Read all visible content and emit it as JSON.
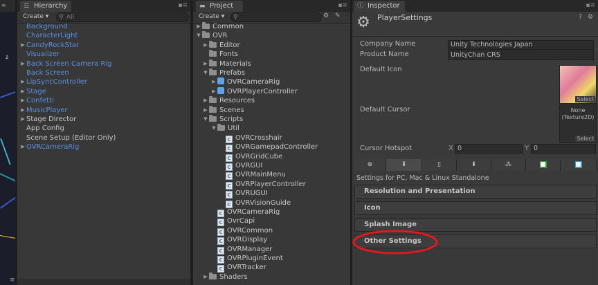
{
  "scene": {
    "axis_label": "z",
    "footer": "≡"
  },
  "hierarchy": {
    "tab_label": "Hierarchy",
    "create_label": "Create ▾",
    "search_placeholder": "All",
    "items": [
      {
        "label": "Background",
        "color": "blue",
        "arrow": ""
      },
      {
        "label": "CharacterLight",
        "color": "blue",
        "arrow": ""
      },
      {
        "label": "CandyRockStar",
        "color": "blue",
        "arrow": "▶"
      },
      {
        "label": "Visualizer",
        "color": "blue",
        "arrow": ""
      },
      {
        "label": "Back Screen Camera Rig",
        "color": "blue",
        "arrow": "▶"
      },
      {
        "label": "Back Screen",
        "color": "blue",
        "arrow": ""
      },
      {
        "label": "LipSyncController",
        "color": "blue",
        "arrow": "▶"
      },
      {
        "label": "Stage",
        "color": "blue",
        "arrow": "▶"
      },
      {
        "label": "Confetti",
        "color": "blue",
        "arrow": "▶"
      },
      {
        "label": "MusicPlayer",
        "color": "blue",
        "arrow": "▶"
      },
      {
        "label": "Stage Director",
        "color": "white",
        "arrow": "▶"
      },
      {
        "label": "App Config",
        "color": "white",
        "arrow": ""
      },
      {
        "label": "Scene Setup (Editor Only)",
        "color": "white",
        "arrow": ""
      },
      {
        "label": "OVRCameraRig",
        "color": "blue",
        "arrow": "▶"
      }
    ]
  },
  "project": {
    "tab_label": "Project",
    "create_label": "Create ▾",
    "items": [
      {
        "label": "Common",
        "type": "folder",
        "arrow": "▶",
        "indent": 0
      },
      {
        "label": "OVR",
        "type": "folder",
        "arrow": "▼",
        "indent": 0
      },
      {
        "label": "Editor",
        "type": "folder",
        "arrow": "▶",
        "indent": 1
      },
      {
        "label": "Fonts",
        "type": "folder",
        "arrow": "",
        "indent": 1
      },
      {
        "label": "Materials",
        "type": "folder",
        "arrow": "▶",
        "indent": 1
      },
      {
        "label": "Prefabs",
        "type": "folder",
        "arrow": "▼",
        "indent": 1
      },
      {
        "label": "OVRCameraRig",
        "type": "prefab",
        "arrow": "▶",
        "indent": 2
      },
      {
        "label": "OVRPlayerController",
        "type": "prefab",
        "arrow": "▶",
        "indent": 2
      },
      {
        "label": "Resources",
        "type": "folder",
        "arrow": "▶",
        "indent": 1
      },
      {
        "label": "Scenes",
        "type": "folder",
        "arrow": "▶",
        "indent": 1
      },
      {
        "label": "Scripts",
        "type": "folder",
        "arrow": "▼",
        "indent": 1
      },
      {
        "label": "Util",
        "type": "folder",
        "arrow": "▼",
        "indent": 2
      },
      {
        "label": "OVRCrosshair",
        "type": "script",
        "arrow": "",
        "indent": 3
      },
      {
        "label": "OVRGamepadController",
        "type": "script",
        "arrow": "",
        "indent": 3
      },
      {
        "label": "OVRGridCube",
        "type": "script",
        "arrow": "",
        "indent": 3
      },
      {
        "label": "OVRGUI",
        "type": "script",
        "arrow": "",
        "indent": 3
      },
      {
        "label": "OVRMainMenu",
        "type": "script",
        "arrow": "",
        "indent": 3
      },
      {
        "label": "OVRPlayerController",
        "type": "script",
        "arrow": "",
        "indent": 3
      },
      {
        "label": "OVRUGUI",
        "type": "script",
        "arrow": "",
        "indent": 3
      },
      {
        "label": "OVRVisionGuide",
        "type": "script",
        "arrow": "",
        "indent": 3
      },
      {
        "label": "OVRCameraRig",
        "type": "script",
        "arrow": "",
        "indent": 2
      },
      {
        "label": "OvrCapi",
        "type": "script",
        "arrow": "",
        "indent": 2
      },
      {
        "label": "OVRCommon",
        "type": "script",
        "arrow": "",
        "indent": 2
      },
      {
        "label": "OVRDisplay",
        "type": "script",
        "arrow": "",
        "indent": 2
      },
      {
        "label": "OVRManager",
        "type": "script",
        "arrow": "",
        "indent": 2
      },
      {
        "label": "OVRPluginEvent",
        "type": "script",
        "arrow": "",
        "indent": 2
      },
      {
        "label": "OVRTracker",
        "type": "script",
        "arrow": "",
        "indent": 2
      },
      {
        "label": "Shaders",
        "type": "folder",
        "arrow": "▶",
        "indent": 1
      }
    ]
  },
  "inspector": {
    "tab_label": "Inspector",
    "title": "PlayerSettings",
    "company_label": "Company Name",
    "company_value": "Unity Technologies Japan",
    "product_label": "Product Name",
    "product_value": "UnityChan CRS",
    "icon_label": "Default Icon",
    "icon_select": "Select",
    "cursor_label": "Default Cursor",
    "cursor_none": "None",
    "cursor_type": "(Texture2D)",
    "cursor_select": "Select",
    "hotspot_label": "Cursor Hotspot",
    "hotspot_x_label": "X",
    "hotspot_x": "0",
    "hotspot_y_label": "Y",
    "hotspot_y": "0",
    "platform_icons": [
      "web-icon",
      "standalone-download-icon",
      "ios-icon",
      "android-icon",
      "blackberry-icon",
      "xbox-icon",
      "windows-store-icon"
    ],
    "settings_for": "Settings for PC, Mac & Linux Standalone",
    "sections": [
      "Resolution and Presentation",
      "Icon",
      "Splash Image",
      "Other Settings"
    ],
    "highlight_color": "#e0191e"
  }
}
